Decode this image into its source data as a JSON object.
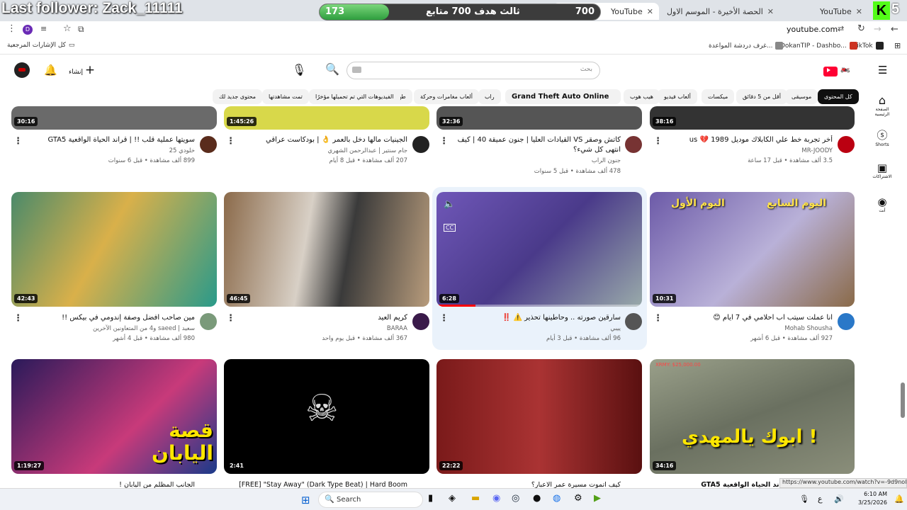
{
  "overlay": {
    "last_follower": "Last follower: Zack_11111",
    "goal": {
      "current": "173",
      "label": "ثالث هدف 700 متابع",
      "max": "700",
      "progress": 0.247
    },
    "kick_count": "5"
  },
  "browser": {
    "tabs": [
      {
        "label": "YouTube",
        "active": false
      },
      {
        "label": "الحصة الأخيرة - الموسم الاول - 3",
        "active": false
      },
      {
        "label": "YouTube",
        "active": true
      }
    ],
    "url": "youtube.com",
    "bookmarks": [
      {
        "label": "كل الإشارات المرجعية"
      },
      {
        "label": "TikTok"
      },
      {
        "label": "DokanTIP - Dashbo..."
      },
      {
        "label": "غرف دردشة المواعدة..."
      }
    ],
    "profile_initial": "D"
  },
  "youtube": {
    "search_placeholder": "بحث",
    "create_label": "إنشاء",
    "chips": [
      "كل المحتوى",
      "موسيقى",
      "أقل من 5 دقائق",
      "ميكسات",
      "ألعاب فيديو",
      "هيب هوب",
      "مباشر",
      "Grand Theft Auto Online",
      "راب",
      "ألعاب مغامرات وحركة",
      "طهي",
      "الفيديوهات التي تم تحميلها مؤخرًا",
      "تمت مشاهدتها",
      "محتوى جديد لك"
    ],
    "guide": [
      "الصفحة الرئيسية",
      "Shorts",
      "الاشتراكات",
      "أنت"
    ],
    "row1": [
      {
        "duration": "38:16",
        "title": "أخر تجربة خط علي الكابلاك موديل 1989 💔 us",
        "channel": "MR-JOODY",
        "stats": "3.5 ألف مشاهدة • قبل 17 ساعة"
      },
      {
        "duration": "32:36",
        "title": "كاتش وصقر VS القيادات العليا | جنون عميقة 40 | كيف انتهى كل شيء؟",
        "channel": "جنون الراب",
        "stats": "478 ألف مشاهدة • قبل 5 سنوات"
      },
      {
        "duration": "1:45:26",
        "title": "الجينيات مالها دخل بالعمر 👌 | بودكاست عراقي",
        "channel": "جام سنتير | عبدالرحمن الشهري",
        "stats": "207 ألف مشاهدة • قبل 8 أيام"
      },
      {
        "duration": "30:16",
        "title": "سويتها عملية قلب !! | قراند الحياة الواقعية GTA5",
        "channel": "خلودي 25",
        "stats": "899 ألف مشاهدة • قبل 6 سنوات"
      }
    ],
    "row2": [
      {
        "duration": "10:31",
        "title": "انا عملت سيتب اب احلامي في 7 ايام 😊",
        "channel": "Mohab Shousha",
        "stats": "927 ألف مشاهدة • قبل 6 أشهر"
      },
      {
        "duration": "6:28",
        "title": "سارقين صورته .. وحاطينها تحذير ⚠️ ‼️",
        "channel": "ييبي",
        "stats": "96 ألف مشاهدة • قبل 3 أيام"
      },
      {
        "duration": "46:45",
        "title": "كريم العيد",
        "channel": "BARAA",
        "stats": "367 ألف مشاهدة • قبل يوم واحد"
      },
      {
        "duration": "42:43",
        "title": "مين صاحب افضل وصفة إندومي في بيكس !!",
        "channel": "سعيد | saeed و4 من المتعاونين الآخرين",
        "stats": "980 ألف مشاهدة • قبل 4 أشهر"
      }
    ],
    "row3": [
      {
        "duration": "34:16",
        "title": "قراند الحياة الواقعية GTA5",
        "thumb_text": "ابوك يالمهدي !",
        "hud": "XRMY: $25,000.00"
      },
      {
        "duration": "22:22",
        "title": "كيف اتموت مسيرة عمر الاعبار؟"
      },
      {
        "duration": "2:41",
        "title": "[FREE] \"Stay Away\" (Dark Type Beat) | Hard Boom"
      },
      {
        "duration": "1:19:27",
        "title": "الجانب المظلم من اليابان !",
        "thumb_text": "قصة اليابان"
      }
    ],
    "status_url": "https://www.youtube.com/watch?v=-9d9nolqUJ0"
  },
  "taskbar": {
    "search": "Search",
    "time": "6:10 AM",
    "date": "3/25/2026",
    "lang": "ع"
  },
  "colors": {
    "yt_red": "#ff0033",
    "kick_green": "#53fc18",
    "progress_red": "#ff0000",
    "selected_card_bg": "#eaf2fb"
  }
}
